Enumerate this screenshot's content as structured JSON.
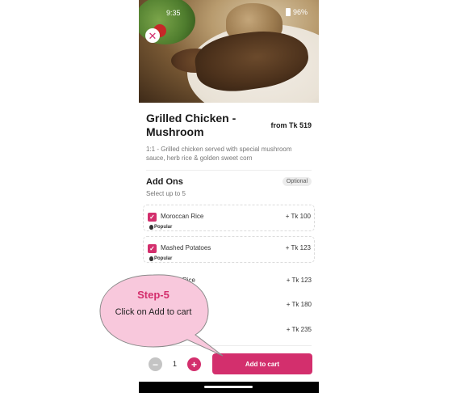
{
  "status_bar": {
    "time": "9:35",
    "battery": "96%"
  },
  "item": {
    "title_line1": "Grilled Chicken -",
    "title_line2": "Mushroom",
    "price_from": "from Tk 519",
    "description": "1:1 - Grilled chicken served with special mushroom sauce, herb rice & golden sweet corn"
  },
  "addons": {
    "title": "Add Ons",
    "subtitle": "Select up to 5",
    "badge": "Optional",
    "items": [
      {
        "name": "Moroccan Rice",
        "price": "+ Tk 100",
        "checked": true,
        "popular_label": "Popular"
      },
      {
        "name": "Mashed Potatoes",
        "price": "+ Tk 123",
        "checked": true,
        "popular_label": "Popular"
      },
      {
        "name": "Rice",
        "price": "+ Tk 123",
        "checked": false
      },
      {
        "name": "",
        "price": "+ Tk 180",
        "checked": false
      },
      {
        "name": "",
        "price": "+ Tk 235",
        "checked": false
      }
    ]
  },
  "cart": {
    "quantity": "1",
    "minus_symbol": "−",
    "plus_symbol": "+",
    "add_label": "Add to cart"
  },
  "callout": {
    "step": "Step-5",
    "instruction": "Click on Add to cart"
  },
  "colors": {
    "accent": "#d32f6d",
    "callout_fill": "#f8c8dc"
  },
  "icons": {
    "close": "close-icon",
    "check": "checkmark-icon",
    "flame": "flame-icon",
    "battery": "battery-icon"
  }
}
